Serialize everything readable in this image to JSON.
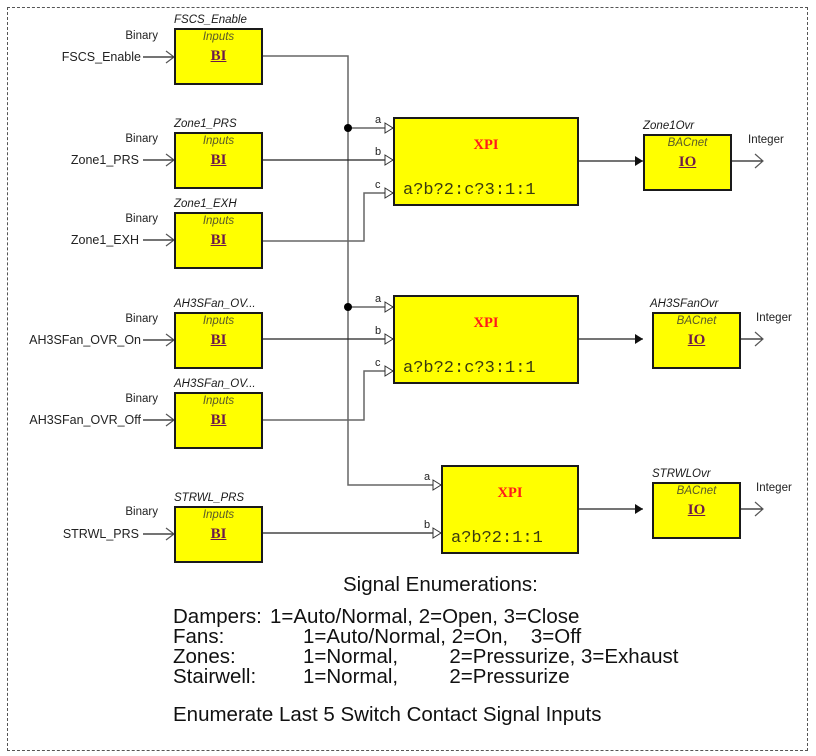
{
  "diagram": {
    "inputs": [
      {
        "id": "bi1",
        "signal_label": "FSCS_Enable",
        "type_label": "Binary",
        "block_title": "FSCS_Enable",
        "block_sub": "Inputs",
        "block_kind": "BI"
      },
      {
        "id": "bi2",
        "signal_label": "Zone1_PRS",
        "type_label": "Binary",
        "block_title": "Zone1_PRS",
        "block_sub": "Inputs",
        "block_kind": "BI"
      },
      {
        "id": "bi3",
        "signal_label": "Zone1_EXH",
        "type_label": "Binary",
        "block_title": "Zone1_EXH",
        "block_sub": "Inputs",
        "block_kind": "BI"
      },
      {
        "id": "bi4",
        "signal_label": "AH3SFan_OVR_On",
        "type_label": "Binary",
        "block_title": "AH3SFan_OV...",
        "block_sub": "Inputs",
        "block_kind": "BI"
      },
      {
        "id": "bi5",
        "signal_label": "AH3SFan_OVR_Off",
        "type_label": "Binary",
        "block_title": "AH3SFan_OV...",
        "block_sub": "Inputs",
        "block_kind": "BI"
      },
      {
        "id": "bi6",
        "signal_label": "STRWL_PRS",
        "type_label": "Binary",
        "block_title": "STRWL_PRS",
        "block_sub": "Inputs",
        "block_kind": "BI"
      }
    ],
    "logic": [
      {
        "id": "xpi1",
        "name": "XPI",
        "expression": "a?b?2:c?3:1:1",
        "pins": [
          "a",
          "b",
          "c"
        ]
      },
      {
        "id": "xpi2",
        "name": "XPI",
        "expression": "a?b?2:c?3:1:1",
        "pins": [
          "a",
          "b",
          "c"
        ]
      },
      {
        "id": "xpi3",
        "name": "XPI",
        "expression": "a?b?2:1:1",
        "pins": [
          "a",
          "b"
        ]
      }
    ],
    "outputs": [
      {
        "id": "io1",
        "block_title": "Zone1Ovr",
        "block_sub": "BACnet",
        "block_kind": "IO",
        "type_label": "Integer"
      },
      {
        "id": "io2",
        "block_title": "AH3SFanOvr",
        "block_sub": "BACnet",
        "block_kind": "IO",
        "type_label": "Integer"
      },
      {
        "id": "io3",
        "block_title": "STRWLOvr",
        "block_sub": "BACnet",
        "block_kind": "IO",
        "type_label": "Integer"
      }
    ]
  },
  "legend": {
    "title": "Signal Enumerations:",
    "rows": [
      {
        "name": "Dampers:",
        "values": "1=Auto/Normal, 2=Open, 3=Close"
      },
      {
        "name": "Fans:",
        "values": "1=Auto/Normal, 2=On,    3=Off"
      },
      {
        "name": "Zones:",
        "values": "1=Normal,         2=Pressurize, 3=Exhaust"
      },
      {
        "name": "Stairwell:",
        "values": "1=Normal,         2=Pressurize"
      }
    ],
    "footer": "Enumerate Last 5 Switch Contact Signal Inputs"
  },
  "colors": {
    "block_fill": "#ffff00",
    "xpi_name": "#ff1a1a",
    "block_kind": "#6b1a4a"
  }
}
